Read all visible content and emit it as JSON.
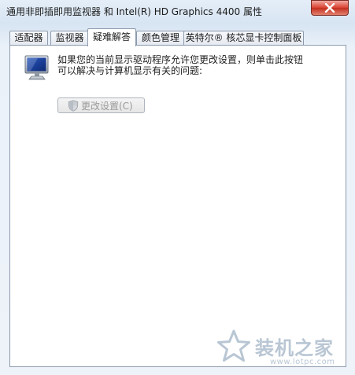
{
  "window": {
    "title": "通用非即插即用监视器 和 Intel(R) HD Graphics 4400 属性"
  },
  "tabs": [
    {
      "label": "适配器"
    },
    {
      "label": "监视器"
    },
    {
      "label": "疑难解答",
      "active": true
    },
    {
      "label": "颜色管理"
    },
    {
      "label": "英特尔® 核芯显卡控制面板"
    }
  ],
  "troubleshoot": {
    "description_line1": "如果您的当前显示驱动程序允许您更改设置，则单击此按钮",
    "description_line2": "可以解决与计算机显示有关的问题:",
    "change_settings_label": "更改设置(C)",
    "change_settings_enabled": false
  },
  "watermark": {
    "brand": "装机之家",
    "url": "www.lotpc.com"
  },
  "icons": {
    "close": "close-icon",
    "monitor": "monitor-icon",
    "shield": "shield-icon",
    "star": "star-icon"
  }
}
